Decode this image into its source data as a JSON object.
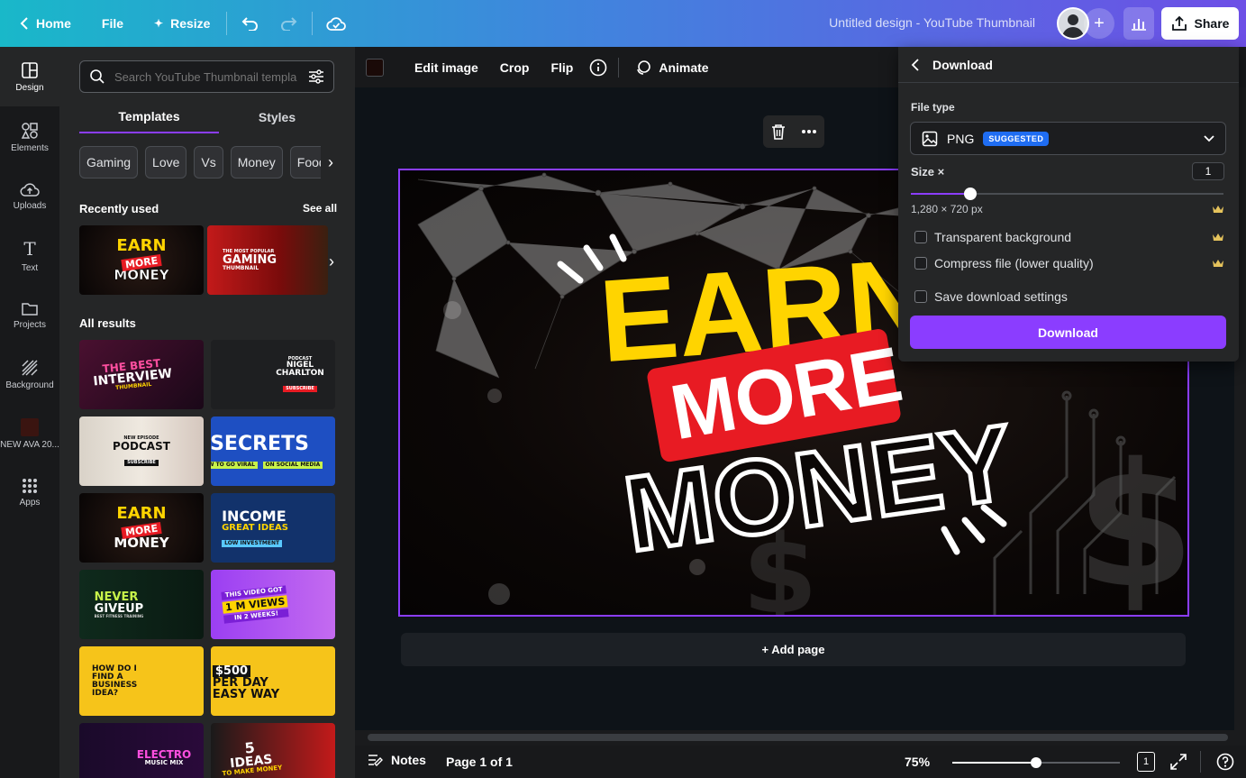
{
  "topbar": {
    "home": "Home",
    "file": "File",
    "resize": "Resize",
    "doc_title": "Untitled design - YouTube Thumbnail",
    "share": "Share"
  },
  "rail": {
    "items": [
      {
        "label": "Design",
        "icon": "design-icon"
      },
      {
        "label": "Elements",
        "icon": "elements-icon"
      },
      {
        "label": "Uploads",
        "icon": "uploads-icon"
      },
      {
        "label": "Text",
        "icon": "text-icon"
      },
      {
        "label": "Projects",
        "icon": "projects-icon"
      },
      {
        "label": "Background",
        "icon": "background-icon"
      },
      {
        "label": "NEW AVA 20...",
        "icon": "project-thumbnail"
      },
      {
        "label": "Apps",
        "icon": "apps-icon"
      }
    ]
  },
  "panel": {
    "search_placeholder": "Search YouTube Thumbnail templa",
    "tabs": [
      "Templates",
      "Styles"
    ],
    "chips": [
      "Gaming",
      "Love",
      "Vs",
      "Money",
      "Food"
    ],
    "recently_used": "Recently used",
    "see_all": "See all",
    "all_results": "All results",
    "recent": [
      {
        "line1": "EARN",
        "line2": "MORE",
        "line3": "MONEY"
      },
      {
        "line1": "THE MOST POPULAR",
        "line2": "GAMING",
        "line3": "THUMBNAIL"
      }
    ],
    "results": [
      {
        "line1": "THE BEST",
        "line2": "INTERVIEW",
        "line3": "THUMBNAIL"
      },
      {
        "line1": "PODCAST",
        "line2": "NIGEL CHARLTON",
        "line3": "SUBSCRIBE"
      },
      {
        "line1": "NEW EPISODE",
        "line2": "PODCAST",
        "line3": "SUBSCRIBE"
      },
      {
        "line1": "SECRETS",
        "line2": "HOW TO GO VIRAL",
        "line3": "ON SOCIAL MEDIA"
      },
      {
        "line1": "EARN",
        "line2": "MORE",
        "line3": "MONEY"
      },
      {
        "line1": "INCOME",
        "line2": "GREAT IDEAS",
        "line3": "LOW INVESTMENT"
      },
      {
        "line1": "NEVER",
        "line2": "GIVEUP",
        "line3": "BEST FITNESS TRAINING"
      },
      {
        "line1": "THIS VIDEO GOT",
        "line2": "1 M VIEWS",
        "line3": "IN 2 WEEKS!"
      },
      {
        "line1": "HOW DO I",
        "line2": "FIND A BUSINESS",
        "line3": "IDEA?"
      },
      {
        "line1": "$500",
        "line2": "PER DAY",
        "line3": "EASY WAY"
      },
      {
        "line1": "ELECTRO",
        "line2": "MUSIC MIX",
        "line3": ""
      },
      {
        "line1": "5",
        "line2": "IDEAS",
        "line3": "TO MAKE MONEY"
      }
    ]
  },
  "context_toolbar": {
    "edit_image": "Edit image",
    "crop": "Crop",
    "flip": "Flip",
    "animate": "Animate"
  },
  "design": {
    "earn": "EARN",
    "more": "MORE",
    "money": "MONEY"
  },
  "canvas": {
    "add_page": "+ Add page"
  },
  "bottombar": {
    "notes": "Notes",
    "page": "Page 1 of 1",
    "zoom": "75%",
    "zoom_level": 0.5,
    "page_count": "1"
  },
  "download": {
    "title": "Download",
    "file_type_label": "File type",
    "file_type": "PNG",
    "suggested": "SUGGESTED",
    "size_label": "Size ×",
    "size_value": "1",
    "size_level": 0.19,
    "dimensions": "1,280 × 720 px",
    "transparent": "Transparent background",
    "compress": "Compress file (lower quality)",
    "save_settings": "Save download settings",
    "button": "Download"
  },
  "colors": {
    "accent": "#8b3dff",
    "earn_yellow": "#ffd400",
    "more_red": "#e81b23"
  }
}
